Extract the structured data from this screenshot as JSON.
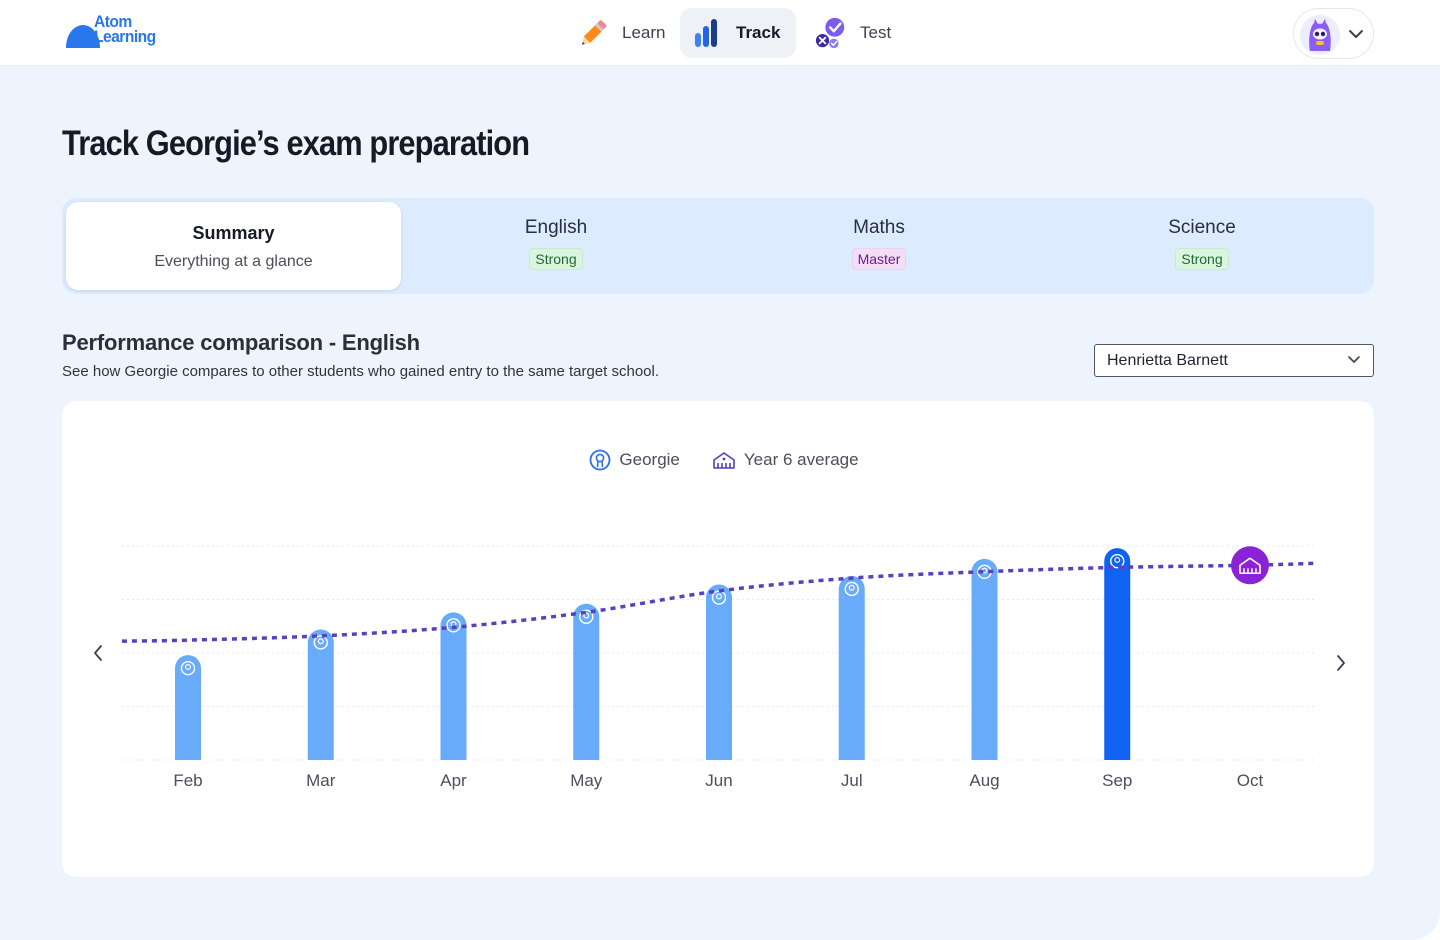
{
  "brand": {
    "line1": "Atom",
    "line2": "Learning",
    "color": "#2877ec"
  },
  "nav": {
    "learn": {
      "label": "Learn",
      "icon": "pencil-icon"
    },
    "track": {
      "label": "Track",
      "icon": "bar-chart-icon"
    },
    "test": {
      "label": "Test",
      "icon": "check-cross-icon"
    }
  },
  "profile": {
    "avatar": "monster-avatar-icon"
  },
  "page": {
    "title": "Track Georgie’s exam preparation"
  },
  "tabs": {
    "summary": {
      "title": "Summary",
      "subtitle": "Everything at a glance"
    },
    "english": {
      "title": "English",
      "badge": "Strong"
    },
    "maths": {
      "title": "Maths",
      "badge": "Master"
    },
    "science": {
      "title": "Science",
      "badge": "Strong"
    }
  },
  "section": {
    "title": "Performance comparison - English",
    "subtitle": "See how Georgie compares to other students who gained entry to the same target school."
  },
  "school_select": {
    "value": "Henrietta Barnett"
  },
  "legend": {
    "student": "Georgie",
    "average": "Year 6 average"
  },
  "colors": {
    "bar": "#69abfb",
    "bar_current": "#0f62f2",
    "average_line": "#5a3fbf",
    "target_marker": "#8a22d6",
    "grid": "#e7e9ee"
  },
  "chart_data": {
    "type": "bar",
    "categories": [
      "Feb",
      "Mar",
      "Apr",
      "May",
      "Jun",
      "Jul",
      "Aug",
      "Sep",
      "Oct"
    ],
    "ylim": [
      0,
      100
    ],
    "grid": true,
    "legend_position": "top-center",
    "series": [
      {
        "name": "Georgie",
        "type": "bar",
        "values": [
          49,
          61,
          69,
          73,
          82,
          86,
          94,
          99,
          null
        ],
        "highlight_index": 7
      },
      {
        "name": "Year 6 average",
        "type": "line",
        "style": "dotted",
        "values": [
          56,
          58,
          62,
          69,
          79,
          85,
          88,
          90,
          91
        ],
        "marker_index": 8
      }
    ]
  }
}
